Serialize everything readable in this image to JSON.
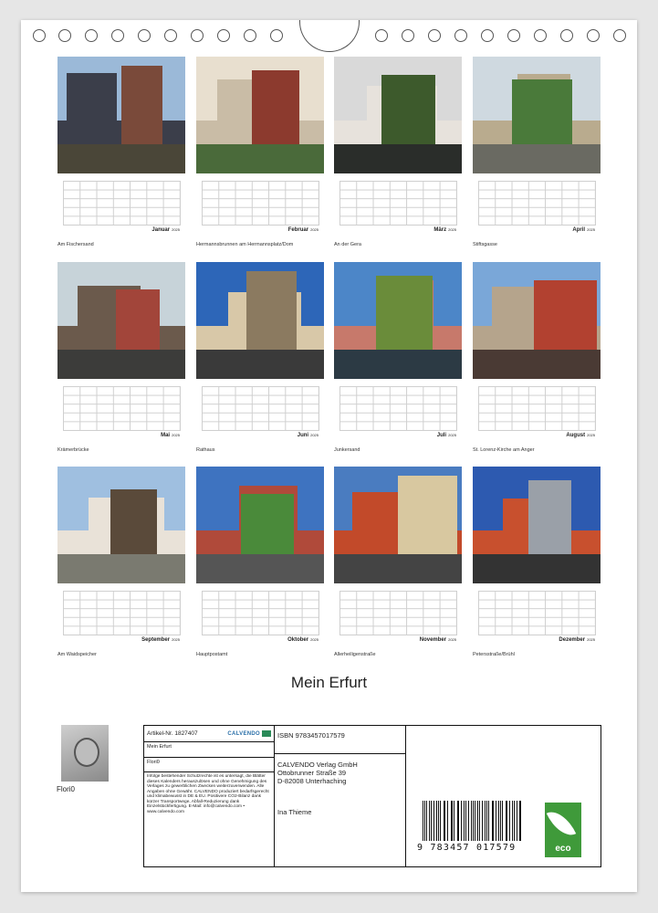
{
  "title": "Mein Erfurt",
  "months": [
    {
      "name": "Januar",
      "year": "2025",
      "caption": "Am Fischersand",
      "palette": {
        "sky": "#9bb9d8",
        "b1": "#3b3e4a",
        "b2": "#7a4a3a",
        "ground": "#4a4638"
      }
    },
    {
      "name": "Februar",
      "year": "2025",
      "caption": "Hermannsbrunnen am Hermannsplatz/Dom",
      "palette": {
        "sky": "#e8dfcf",
        "b1": "#c9bca6",
        "b2": "#8c3a2e",
        "ground": "#4a6a3a"
      }
    },
    {
      "name": "März",
      "year": "2025",
      "caption": "An der Gera",
      "palette": {
        "sky": "#d9d9d9",
        "b1": "#e7e2dc",
        "b2": "#3d5a2c",
        "ground": "#2a2d2a"
      }
    },
    {
      "name": "April",
      "year": "2025",
      "caption": "Stiftsgasse",
      "palette": {
        "sky": "#cfd9e0",
        "b1": "#b9ab8e",
        "b2": "#4a7a3a",
        "ground": "#6a6a62"
      }
    },
    {
      "name": "Mai",
      "year": "2025",
      "caption": "Krämerbrücke",
      "palette": {
        "sky": "#c7d3d9",
        "b1": "#6b5a4c",
        "b2": "#a2453a",
        "ground": "#3c3c3a"
      }
    },
    {
      "name": "Juni",
      "year": "2025",
      "caption": "Rathaus",
      "palette": {
        "sky": "#2d66b8",
        "b1": "#d8c8a8",
        "b2": "#8b7a60",
        "ground": "#3a3a3a"
      }
    },
    {
      "name": "Juli",
      "year": "2025",
      "caption": "Junkersand",
      "palette": {
        "sky": "#4c86c8",
        "b1": "#c7796b",
        "b2": "#6a8c3a",
        "ground": "#2c3a44"
      }
    },
    {
      "name": "August",
      "year": "2025",
      "caption": "St. Lorenz-Kirche am Anger",
      "palette": {
        "sky": "#7aa7d8",
        "b1": "#b5a48c",
        "b2": "#b24130",
        "ground": "#4a3a34"
      }
    },
    {
      "name": "September",
      "year": "2025",
      "caption": "Am Waidspeicher",
      "palette": {
        "sky": "#9fbfe0",
        "b1": "#e9e2d8",
        "b2": "#5a4a3a",
        "ground": "#7a7a70"
      }
    },
    {
      "name": "Oktober",
      "year": "2025",
      "caption": "Hauptpostamt",
      "palette": {
        "sky": "#3e73c0",
        "b1": "#b04a3a",
        "b2": "#4a8a3a",
        "ground": "#555"
      }
    },
    {
      "name": "November",
      "year": "2025",
      "caption": "Allerheiligenstraße",
      "palette": {
        "sky": "#4a7cc0",
        "b1": "#c24a2a",
        "b2": "#d8c8a0",
        "ground": "#444"
      }
    },
    {
      "name": "Dezember",
      "year": "2025",
      "caption": "Petersstraße/Brühl",
      "palette": {
        "sky": "#2d5ab0",
        "b1": "#c8502e",
        "b2": "#9aa0a8",
        "ground": "#333"
      }
    }
  ],
  "author": {
    "name": "Flori0"
  },
  "info": {
    "artikel": "Artikel-Nr. 1827407",
    "brand": "CALVENDO",
    "calendar_title": "Mein Erfurt",
    "calendar_author": "Flori0",
    "notice": "Infolge bestehender Schutzrechte ist es untersagt, die Blätter dieses Kalenders herauszulösen und ohne Genehmigung des Verlages zu gewerblichen Zwecken weiterzuverwenden. Alle Angaben ohne Gewähr. CALVENDO produziert bedarfsgerecht und klimabewusst in DE & EU. Positivere CO2-Bilanz dank kürzer Transportwege, Abfall-Reduzierung dank Einzelstückfertigung. E-Mail: info@calvendo.com • www.calvendo.com",
    "isbn": "ISBN 9783457017579",
    "publisher_name": "CALVENDO Verlag GmbH",
    "publisher_street": "Ottobrunner Straße 39",
    "publisher_city": "D-82008 Unterhaching",
    "photographer": "Ina Thieme",
    "barcode_digits": "9 783457 017579",
    "eco_label": "eco"
  }
}
